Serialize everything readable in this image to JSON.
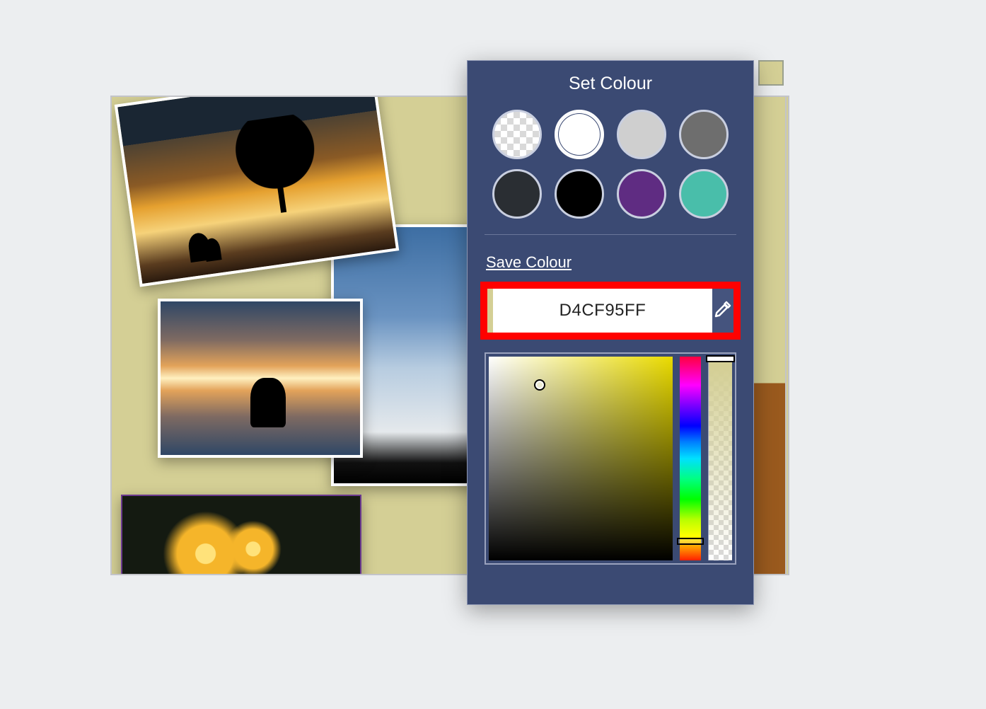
{
  "dialog": {
    "title": "Set Colour",
    "save_label": "Save Colour",
    "hex_value": "D4CF95FF",
    "preview_hex": "#d4cf95",
    "presets": [
      {
        "name": "transparent",
        "css_class": "transparent",
        "color": ""
      },
      {
        "name": "white",
        "color": "#ffffff",
        "selected": true
      },
      {
        "name": "light-grey",
        "color": "#cfcfcf"
      },
      {
        "name": "grey",
        "color": "#6e6e6e"
      },
      {
        "name": "charcoal",
        "color": "#2a2e33"
      },
      {
        "name": "black",
        "color": "#000000"
      },
      {
        "name": "purple",
        "color": "#5f2c82"
      },
      {
        "name": "teal",
        "color": "#49beaa"
      }
    ]
  },
  "canvas": {
    "bg_color": "#d4cf95"
  },
  "corner_swatch_color": "#d4cf95"
}
